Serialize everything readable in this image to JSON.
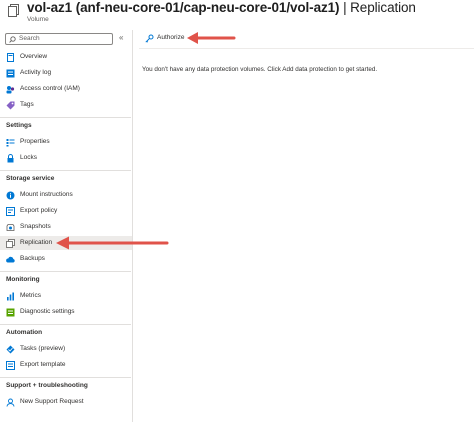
{
  "header": {
    "title": "vol-az1 (anf-neu-core-01/cap-neu-core-01/vol-az1)",
    "separator": " | ",
    "page": "Replication",
    "subtitle": "Volume"
  },
  "search": {
    "placeholder": "Search",
    "icon": "search-icon"
  },
  "collapse_label": "«",
  "nav": {
    "top": [
      {
        "label": "Overview",
        "icon": "overview-icon"
      },
      {
        "label": "Activity log",
        "icon": "activity-log-icon"
      },
      {
        "label": "Access control (IAM)",
        "icon": "iam-icon"
      },
      {
        "label": "Tags",
        "icon": "tag-icon"
      }
    ],
    "settings": {
      "title": "Settings",
      "items": [
        {
          "label": "Properties",
          "icon": "properties-icon"
        },
        {
          "label": "Locks",
          "icon": "lock-icon"
        }
      ]
    },
    "storage": {
      "title": "Storage service",
      "items": [
        {
          "label": "Mount instructions",
          "icon": "info-icon"
        },
        {
          "label": "Export policy",
          "icon": "export-policy-icon"
        },
        {
          "label": "Snapshots",
          "icon": "snapshot-icon"
        },
        {
          "label": "Replication",
          "icon": "replication-icon",
          "selected": true
        },
        {
          "label": "Backups",
          "icon": "backup-icon"
        }
      ]
    },
    "monitoring": {
      "title": "Monitoring",
      "items": [
        {
          "label": "Metrics",
          "icon": "metrics-icon"
        },
        {
          "label": "Diagnostic settings",
          "icon": "diagnostic-icon"
        }
      ]
    },
    "automation": {
      "title": "Automation",
      "items": [
        {
          "label": "Tasks (preview)",
          "icon": "tasks-icon"
        },
        {
          "label": "Export template",
          "icon": "export-template-icon"
        }
      ]
    },
    "support": {
      "title": "Support + troubleshooting",
      "items": [
        {
          "label": "New Support Request",
          "icon": "support-request-icon"
        }
      ]
    }
  },
  "toolbar": {
    "authorize_label": "Authorize",
    "icon": "authorize-icon"
  },
  "main": {
    "empty_message": "You don't have any data protection volumes. Click Add data protection to get started."
  },
  "colors": {
    "accent": "#0078d4",
    "arrow": "#e0534a",
    "selected_bg": "#edebe9"
  }
}
